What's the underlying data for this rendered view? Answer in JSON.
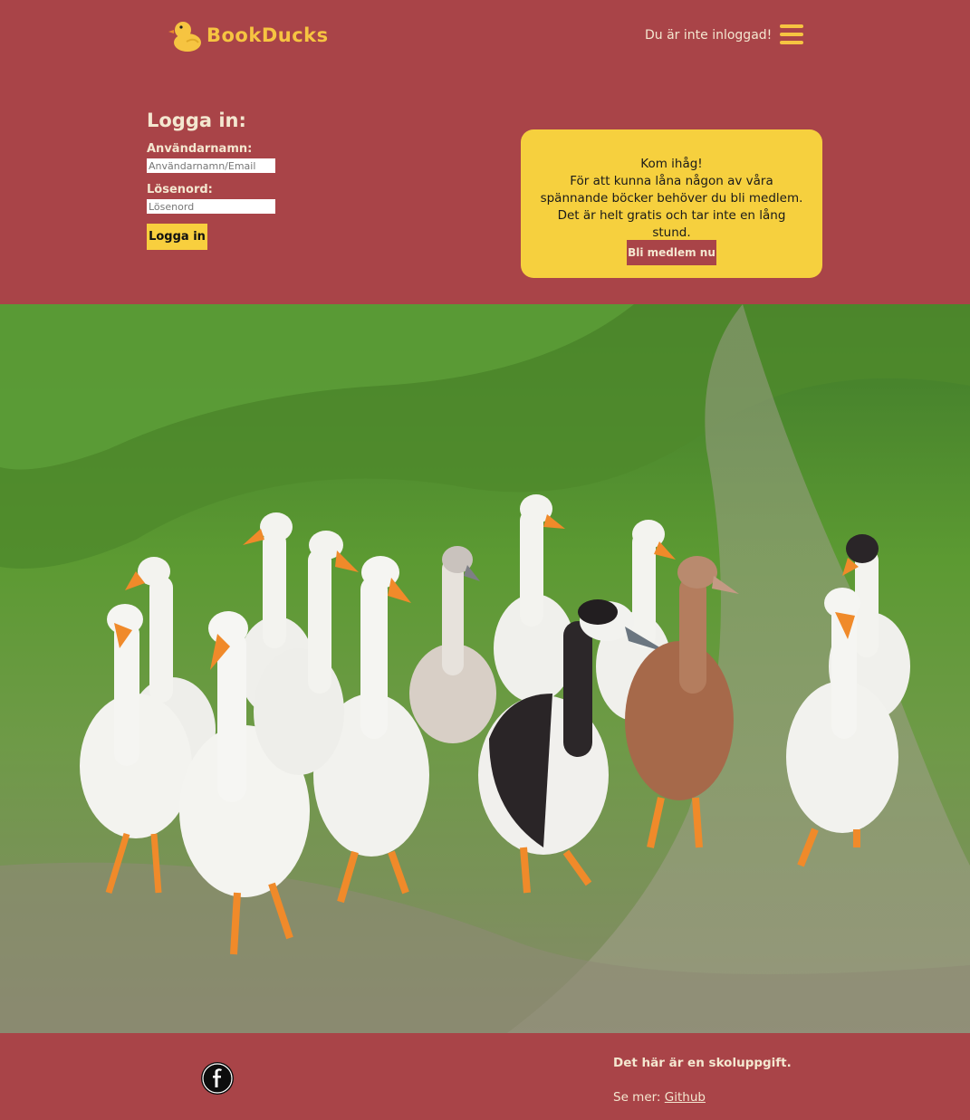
{
  "header": {
    "logo_text": "BookDucks",
    "login_status": "Du är inte inloggad!",
    "menu_icon": "hamburger-menu-icon"
  },
  "login": {
    "title": "Logga in:",
    "username_label": "Användarnamn:",
    "username_placeholder": "Användarnamn/Email",
    "password_label": "Lösenord:",
    "password_placeholder": "Lösenord",
    "submit_label": "Logga in"
  },
  "reminder": {
    "title": "Kom ihåg!",
    "text": "För att kunna låna någon av våra spännande böcker behöver du bli medlem. Det är helt gratis och tar inte en lång stund.",
    "button_label": "Bli medlem nu"
  },
  "hero": {
    "image": "photo-of-ducks-walking-on-grass"
  },
  "footer": {
    "note": "Det här är en skoluppgift.",
    "more_prefix": "Se mer:",
    "link_label": "Github",
    "icon": "circle-logo-icon"
  },
  "colors": {
    "background": "#a94448",
    "accent": "#f6d03e",
    "text_light": "#f4e7d0"
  }
}
